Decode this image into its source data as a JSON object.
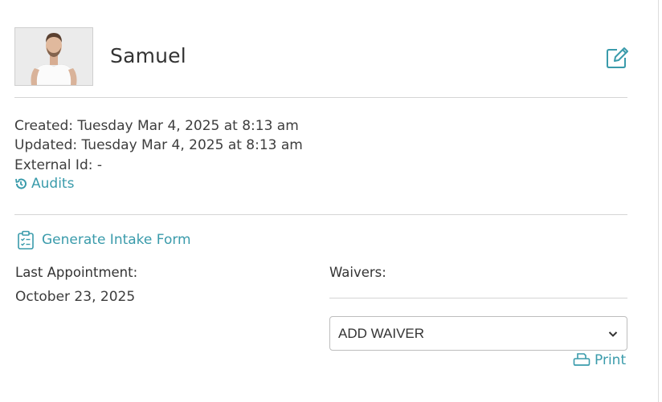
{
  "client": {
    "name": "Samuel",
    "avatar_icon": "person-photo",
    "edit_icon": "edit-icon"
  },
  "details": {
    "created": "Created: Tuesday Mar 4, 2025 at 8:13 am",
    "updated": "Updated: Tuesday Mar 4, 2025 at 8:13 am",
    "external_id": "External Id: -",
    "audits_label": "Audits"
  },
  "actions": {
    "generate_intake_label": "Generate Intake Form"
  },
  "appointment": {
    "label": "Last Appointment:",
    "value": "October 23, 2025"
  },
  "waivers": {
    "label": "Waivers:",
    "select_value": "ADD WAIVER",
    "print_label": "Print"
  },
  "colors": {
    "accent": "#3a9bab",
    "text": "#3d3d3d",
    "divider": "#d5d5d5"
  }
}
